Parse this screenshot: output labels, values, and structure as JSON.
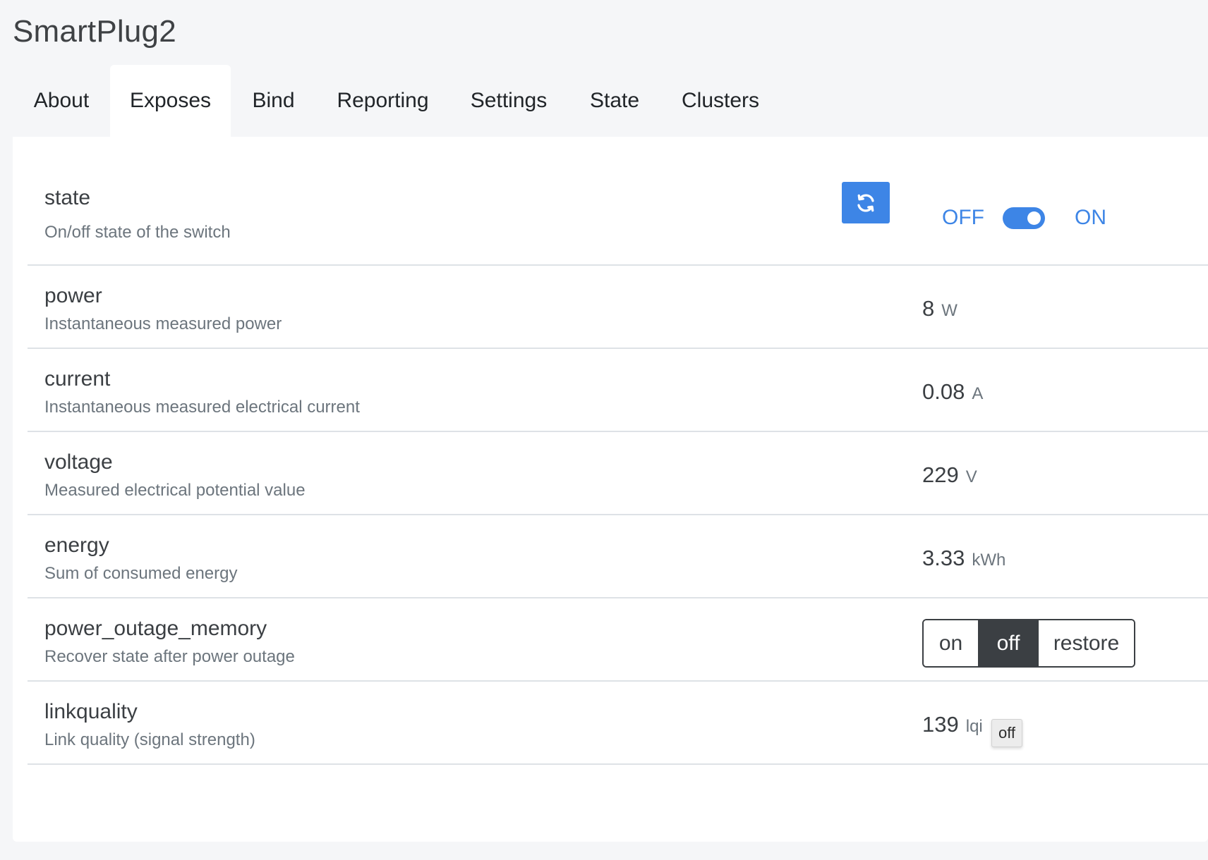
{
  "device": {
    "title": "SmartPlug2"
  },
  "tabs": [
    {
      "label": "About"
    },
    {
      "label": "Exposes"
    },
    {
      "label": "Bind"
    },
    {
      "label": "Reporting"
    },
    {
      "label": "Settings"
    },
    {
      "label": "State"
    },
    {
      "label": "Clusters"
    }
  ],
  "active_tab": "Exposes",
  "exposes": {
    "state": {
      "name": "state",
      "description": "On/off state of the switch",
      "off_label": "OFF",
      "on_label": "ON",
      "value": "ON",
      "refresh_icon": "refresh-icon"
    },
    "power": {
      "name": "power",
      "description": "Instantaneous measured power",
      "value": "8",
      "unit": "W"
    },
    "current": {
      "name": "current",
      "description": "Instantaneous measured electrical current",
      "value": "0.08",
      "unit": "A"
    },
    "voltage": {
      "name": "voltage",
      "description": "Measured electrical potential value",
      "value": "229",
      "unit": "V"
    },
    "energy": {
      "name": "energy",
      "description": "Sum of consumed energy",
      "value": "3.33",
      "unit": "kWh"
    },
    "power_outage_memory": {
      "name": "power_outage_memory",
      "description": "Recover state after power outage",
      "options": [
        "on",
        "off",
        "restore"
      ],
      "selected": "off"
    },
    "linkquality": {
      "name": "linkquality",
      "description": "Link quality (signal strength)",
      "value": "139",
      "unit": "lqi"
    }
  },
  "tooltip": {
    "text": "off"
  },
  "colors": {
    "accent": "#3d85e6",
    "selected_option": "#3b3f43",
    "page_background": "#f5f6f8",
    "card_background": "#ffffff"
  }
}
